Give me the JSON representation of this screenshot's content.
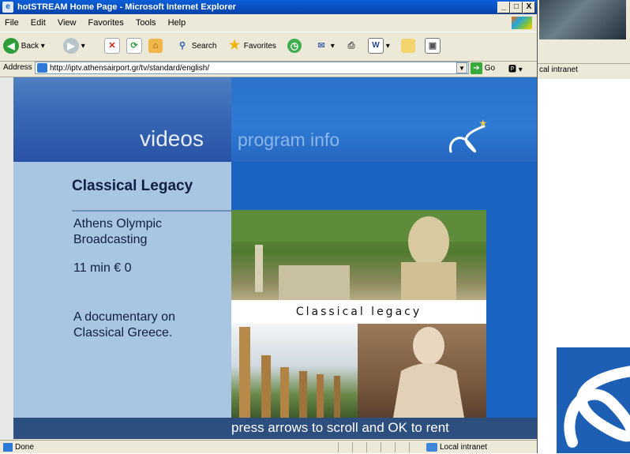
{
  "window": {
    "title": "hotSTREAM Home Page - Microsoft Internet Explorer",
    "min": "_",
    "max": "□",
    "close": "X"
  },
  "menu": [
    "File",
    "Edit",
    "View",
    "Favorites",
    "Tools",
    "Help"
  ],
  "toolbar": {
    "back": "Back",
    "search": "Search",
    "favorites": "Favorites"
  },
  "address": {
    "label": "Address",
    "url": "http://iptv.athensairport.gr/tv/standard/english/",
    "go": "Go"
  },
  "page": {
    "nav_videos": "videos",
    "nav_program": "program info",
    "title": "Classical Legacy",
    "producer": "Athens Olympic Broadcasting",
    "duration_price": "11 min  € 0",
    "description": "A documentary on Classical Greece.",
    "poster_caption": "Classical legacy",
    "bottom_message": "press arrows to scroll and OK to rent"
  },
  "status": {
    "text": "Done",
    "zone": "Local intranet"
  },
  "background_window": {
    "status_zone": "cal intranet"
  },
  "colors": {
    "title_bar": "#0a5fd8",
    "content_blue": "#1a63c0",
    "left_panel": "#a8c5e2",
    "bottom_bar": "#2c4f80"
  }
}
